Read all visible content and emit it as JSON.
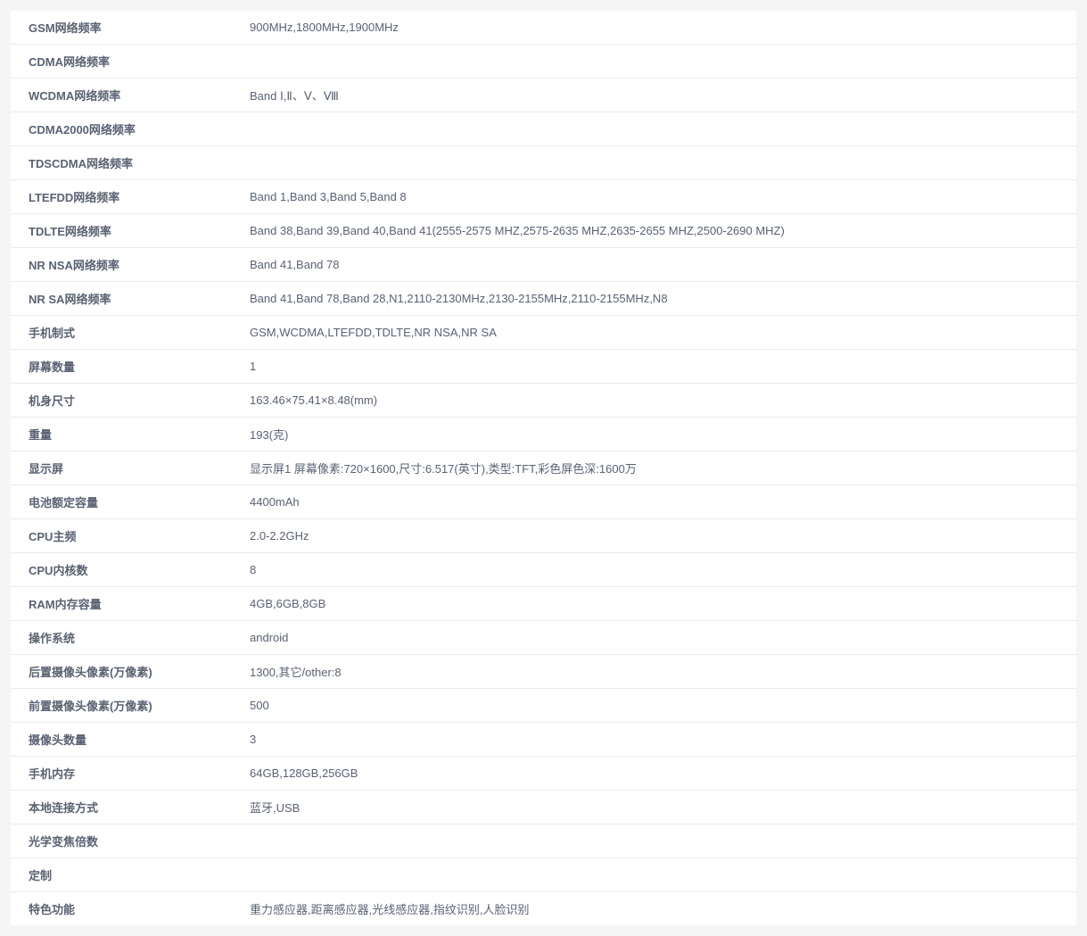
{
  "specs": [
    {
      "label": "GSM网络频率",
      "value": "900MHz,1800MHz,1900MHz"
    },
    {
      "label": "CDMA网络频率",
      "value": ""
    },
    {
      "label": "WCDMA网络频率",
      "value": "Band Ⅰ,Ⅱ、Ⅴ、Ⅷ"
    },
    {
      "label": "CDMA2000网络频率",
      "value": ""
    },
    {
      "label": "TDSCDMA网络频率",
      "value": ""
    },
    {
      "label": "LTEFDD网络频率",
      "value": "Band 1,Band 3,Band 5,Band 8"
    },
    {
      "label": "TDLTE网络频率",
      "value": "Band 38,Band 39,Band 40,Band 41(2555-2575 MHZ,2575-2635 MHZ,2635-2655 MHZ,2500-2690 MHZ)"
    },
    {
      "label": "NR NSA网络频率",
      "value": "Band 41,Band 78"
    },
    {
      "label": "NR SA网络频率",
      "value": "Band 41,Band 78,Band 28,N1,2110-2130MHz,2130-2155MHz,2110-2155MHz,N8"
    },
    {
      "label": "手机制式",
      "value": "GSM,WCDMA,LTEFDD,TDLTE,NR NSA,NR SA"
    },
    {
      "label": "屏幕数量",
      "value": "1"
    },
    {
      "label": "机身尺寸",
      "value": "163.46×75.41×8.48(mm)"
    },
    {
      "label": "重量",
      "value": "193(克)"
    },
    {
      "label": "显示屏",
      "value": "显示屏1 屏幕像素:720×1600,尺寸:6.517(英寸),类型:TFT,彩色屏色深:1600万"
    },
    {
      "label": "电池额定容量",
      "value": "4400mAh"
    },
    {
      "label": "CPU主频",
      "value": "2.0-2.2GHz"
    },
    {
      "label": "CPU内核数",
      "value": "8"
    },
    {
      "label": "RAM内存容量",
      "value": "4GB,6GB,8GB"
    },
    {
      "label": "操作系统",
      "value": "android"
    },
    {
      "label": "后置摄像头像素(万像素)",
      "value": "1300,其它/other:8"
    },
    {
      "label": "前置摄像头像素(万像素)",
      "value": "500"
    },
    {
      "label": "摄像头数量",
      "value": "3"
    },
    {
      "label": "手机内存",
      "value": "64GB,128GB,256GB"
    },
    {
      "label": "本地连接方式",
      "value": "蓝牙,USB"
    },
    {
      "label": "光学变焦倍数",
      "value": ""
    },
    {
      "label": "定制",
      "value": ""
    },
    {
      "label": "特色功能",
      "value": "重力感应器,距离感应器,光线感应器,指纹识别,人脸识别"
    }
  ]
}
